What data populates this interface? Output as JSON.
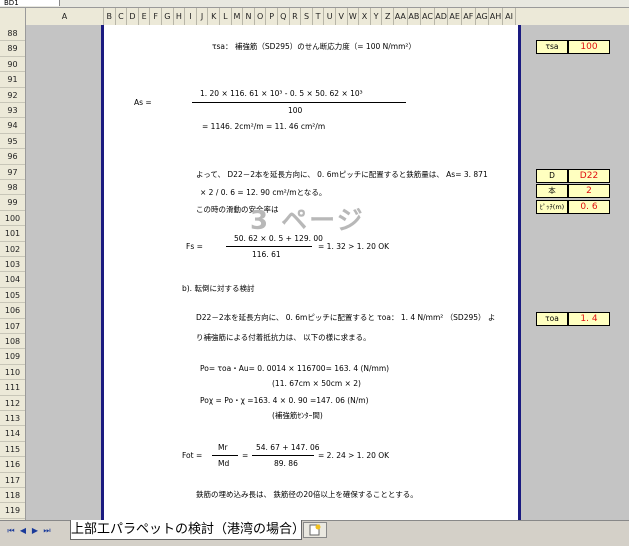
{
  "namebox": "BD1",
  "columns": [
    "A",
    "B",
    "C",
    "D",
    "E",
    "F",
    "G",
    "H",
    "I",
    "J",
    "K",
    "L",
    "M",
    "N",
    "O",
    "P",
    "Q",
    "R",
    "S",
    "T",
    "U",
    "V",
    "W",
    "X",
    "Y",
    "Z",
    "AA",
    "AB",
    "AC",
    "AD",
    "AE",
    "AF",
    "AG",
    "AH",
    "AI"
  ],
  "rows": [
    "88",
    "89",
    "90",
    "91",
    "92",
    "93",
    "94",
    "95",
    "96",
    "97",
    "98",
    "99",
    "100",
    "101",
    "102",
    "103",
    "104",
    "105",
    "106",
    "107",
    "108",
    "109",
    "110",
    "111",
    "112",
    "113",
    "114",
    "115",
    "116",
    "117",
    "118",
    "119"
  ],
  "doc": {
    "line_tsa": "τsa： 補強筋（SD295）のせん断応力度（= 100 N/mm²）",
    "as_label": "As =",
    "as_num": "1. 20 × 116. 61 × 10³ - 0. 5 × 50. 62 × 10³",
    "as_den": "100",
    "as_result": "= 1146. 2cm²/m  =  11. 46 cm²/m",
    "para1a": "よって、 D22－2本を延長方向に、 0. 6mピッチに配置すると鉄筋量は、 As= 3. 871",
    "para1b": "× 2 / 0. 6 = 12. 90 cm²/mとなる。",
    "para2": "この時の滑動の安全率は",
    "fs_label": "Fs =",
    "fs_num": "50. 62 × 0. 5 + 129. 00",
    "fs_den": "116. 61",
    "fs_result": "= 1. 32  >  1. 20   OK",
    "section_b": "b). 転倒に対する検討",
    "para3a": "D22－2本を延長方向に、 0. 6mピッチに配置すると τoa： 1. 4 N/mm² （SD295） よ",
    "para3b": "り補強筋による付着抵抗力は、 以下の様に求まる。",
    "po_line": "Po= τoa・Au= 0. 0014 × 116700= 163. 4 (N/mm)",
    "po_sub": "(11. 67cm × 50cm × 2)",
    "pox_line": "Poχ = Po・χ =163. 4 × 0. 90 =147. 06 (N/m)",
    "pox_sub": "(補強筋ｾﾝﾀｰ間)",
    "fot_label": "Fot =",
    "mr": "Mr",
    "md": "Md",
    "fot_num": "54. 67 + 147. 06",
    "fot_den": "89. 86",
    "fot_result": "= 2. 24  >  1. 20   OK",
    "para4": "鉄筋の埋め込み長は、 鉄筋径の20倍以上を確保することとする。",
    "watermark": "3 ページ"
  },
  "side": {
    "tsa_label": "τsa",
    "tsa_value": "100",
    "d_label": "D",
    "d_value": "D22",
    "hon_label": "本",
    "hon_value": "2",
    "pitch_label": "ﾋﾟｯﾁ(m)",
    "pitch_value": "0. 6",
    "toa_label": "τoa",
    "toa_value": "1. 4"
  },
  "sheet_tab": "上部工パラペットの検討（港湾の場合）",
  "colors": {
    "accent_border": "#1a1a80",
    "value_red": "#e01010",
    "label_bg": "#ffffc0"
  }
}
